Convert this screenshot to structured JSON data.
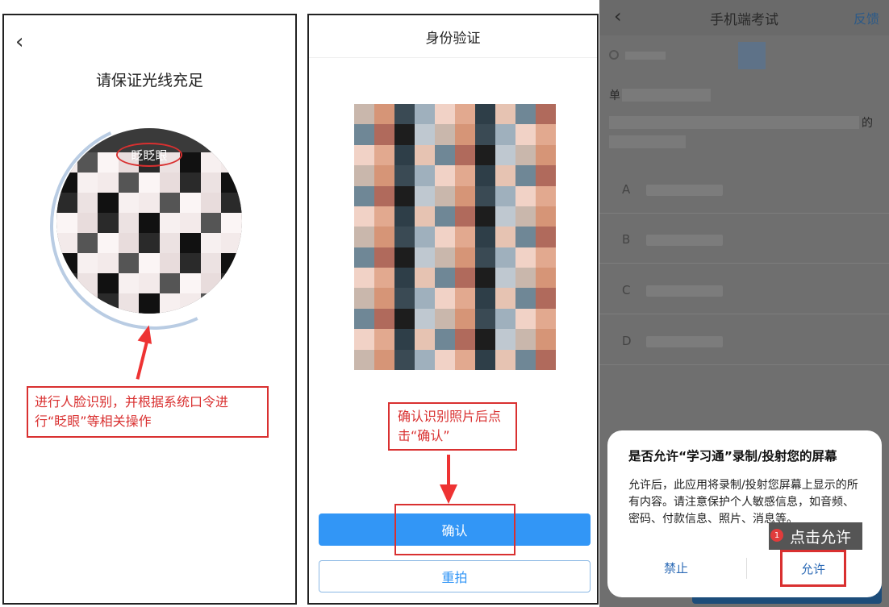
{
  "panel1": {
    "title": "请保证光线充足",
    "blink_tag": "眨眨眼",
    "note": "进行人脸识别，并根据系统口令进行“眨眼”等相关操作"
  },
  "panel2": {
    "title": "身份验证",
    "note": "确认识别照片后点击“确认”",
    "confirm_label": "确认",
    "retake_label": "重拍"
  },
  "panel3": {
    "title": "手机端考试",
    "feedback_label": "反馈",
    "question_head": "单",
    "question_tail": "的",
    "options": [
      "A",
      "B",
      "C",
      "D"
    ],
    "dialog": {
      "title": "是否允许“学习通”录制/投射您的屏幕",
      "body": "允许后，此应用将录制/投射您屏幕上显示的所有内容。请注意保护个人敏感信息，如音频、密码、付款信息、照片、消息等。",
      "deny_label": "禁止",
      "allow_label": "允许"
    },
    "tip": {
      "badge": "1",
      "text": "点击允许"
    }
  },
  "colors": {
    "accent_blue": "#3296f6",
    "annotation_red": "#d93030"
  }
}
